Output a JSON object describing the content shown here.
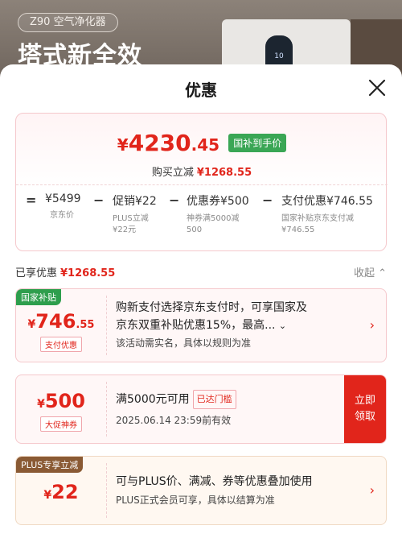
{
  "background": {
    "tag": "Z90 空气净化器",
    "headline": "塔式新全效",
    "device_screen": "10"
  },
  "sheet": {
    "title": "优惠"
  },
  "summary": {
    "currency": "¥",
    "final_int": "4230",
    "final_dec": ".45",
    "final_badge": "国补到手价",
    "reduce_label": "购买立减",
    "reduce_value": "¥1268.55",
    "formula": [
      {
        "op": "=",
        "main_label": "",
        "main_value": "¥5499",
        "sub1": "京东价",
        "sub2": ""
      },
      {
        "op": "−",
        "main_label": "促销",
        "main_value": "¥22",
        "sub1": "PLUS立减",
        "sub2": "¥22元"
      },
      {
        "op": "−",
        "main_label": "优惠券",
        "main_value": "¥500",
        "sub1": "神券满5000减",
        "sub2": "500"
      },
      {
        "op": "−",
        "main_label": "支付优惠",
        "main_value": "¥746.55",
        "sub1": "国家补贴京东支付减",
        "sub2": "¥746.55"
      }
    ]
  },
  "enjoyed": {
    "label": "已享优惠",
    "value": "¥1268.55",
    "collapse_label": "收起"
  },
  "cards": {
    "subsidy": {
      "corner_tag": "国家补贴",
      "currency": "¥",
      "int": "746",
      "dec": ".55",
      "pill": "支付优惠",
      "line1": "购新支付选择京东支付时，可享国家及",
      "line2": "京东双重补贴优惠15%，最高...",
      "line3": "该活动需实名，具体以规则为准"
    },
    "coupon": {
      "currency": "¥",
      "int": "500",
      "pill": "大促神券",
      "line1": "满5000元可用",
      "used_tag": "已达门槛",
      "line2": "2025.06.14 23:59前有效",
      "claim_line1": "立即",
      "claim_line2": "领取"
    },
    "plus": {
      "corner_tag": "PLUS专享立减",
      "currency": "¥",
      "int": "22",
      "line1": "可与PLUS价、满减、券等优惠叠加使用",
      "line2": "PLUS正式会员可享，具体以结算为准"
    }
  },
  "colors": {
    "accent": "#e1251b",
    "badge_green": "#3aa655",
    "plus_tag": "#8a5a34"
  }
}
